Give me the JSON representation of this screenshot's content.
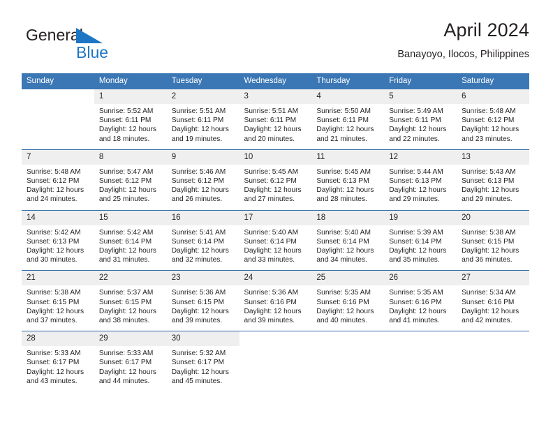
{
  "brand": {
    "name_top": "General",
    "name_bottom": "Blue",
    "logo_icon": "triangle-flag-icon",
    "color_top": "#231f20",
    "color_bottom": "#1d76c4"
  },
  "header": {
    "title": "April 2024",
    "subtitle": "Banayoyo, Ilocos, Philippines"
  },
  "theme": {
    "header_bg": "#3b77b5",
    "header_text": "#ffffff",
    "daynum_bg": "#efefef",
    "divider": "#2e6da4",
    "text": "#231f20"
  },
  "weekday_headers": [
    "Sunday",
    "Monday",
    "Tuesday",
    "Wednesday",
    "Thursday",
    "Friday",
    "Saturday"
  ],
  "weeks": [
    [
      {
        "day": "",
        "sunrise": "",
        "sunset": "",
        "daylight_1": "",
        "daylight_2": ""
      },
      {
        "day": "1",
        "sunrise": "Sunrise: 5:52 AM",
        "sunset": "Sunset: 6:11 PM",
        "daylight_1": "Daylight: 12 hours",
        "daylight_2": "and 18 minutes."
      },
      {
        "day": "2",
        "sunrise": "Sunrise: 5:51 AM",
        "sunset": "Sunset: 6:11 PM",
        "daylight_1": "Daylight: 12 hours",
        "daylight_2": "and 19 minutes."
      },
      {
        "day": "3",
        "sunrise": "Sunrise: 5:51 AM",
        "sunset": "Sunset: 6:11 PM",
        "daylight_1": "Daylight: 12 hours",
        "daylight_2": "and 20 minutes."
      },
      {
        "day": "4",
        "sunrise": "Sunrise: 5:50 AM",
        "sunset": "Sunset: 6:11 PM",
        "daylight_1": "Daylight: 12 hours",
        "daylight_2": "and 21 minutes."
      },
      {
        "day": "5",
        "sunrise": "Sunrise: 5:49 AM",
        "sunset": "Sunset: 6:11 PM",
        "daylight_1": "Daylight: 12 hours",
        "daylight_2": "and 22 minutes."
      },
      {
        "day": "6",
        "sunrise": "Sunrise: 5:48 AM",
        "sunset": "Sunset: 6:12 PM",
        "daylight_1": "Daylight: 12 hours",
        "daylight_2": "and 23 minutes."
      }
    ],
    [
      {
        "day": "7",
        "sunrise": "Sunrise: 5:48 AM",
        "sunset": "Sunset: 6:12 PM",
        "daylight_1": "Daylight: 12 hours",
        "daylight_2": "and 24 minutes."
      },
      {
        "day": "8",
        "sunrise": "Sunrise: 5:47 AM",
        "sunset": "Sunset: 6:12 PM",
        "daylight_1": "Daylight: 12 hours",
        "daylight_2": "and 25 minutes."
      },
      {
        "day": "9",
        "sunrise": "Sunrise: 5:46 AM",
        "sunset": "Sunset: 6:12 PM",
        "daylight_1": "Daylight: 12 hours",
        "daylight_2": "and 26 minutes."
      },
      {
        "day": "10",
        "sunrise": "Sunrise: 5:45 AM",
        "sunset": "Sunset: 6:12 PM",
        "daylight_1": "Daylight: 12 hours",
        "daylight_2": "and 27 minutes."
      },
      {
        "day": "11",
        "sunrise": "Sunrise: 5:45 AM",
        "sunset": "Sunset: 6:13 PM",
        "daylight_1": "Daylight: 12 hours",
        "daylight_2": "and 28 minutes."
      },
      {
        "day": "12",
        "sunrise": "Sunrise: 5:44 AM",
        "sunset": "Sunset: 6:13 PM",
        "daylight_1": "Daylight: 12 hours",
        "daylight_2": "and 29 minutes."
      },
      {
        "day": "13",
        "sunrise": "Sunrise: 5:43 AM",
        "sunset": "Sunset: 6:13 PM",
        "daylight_1": "Daylight: 12 hours",
        "daylight_2": "and 29 minutes."
      }
    ],
    [
      {
        "day": "14",
        "sunrise": "Sunrise: 5:42 AM",
        "sunset": "Sunset: 6:13 PM",
        "daylight_1": "Daylight: 12 hours",
        "daylight_2": "and 30 minutes."
      },
      {
        "day": "15",
        "sunrise": "Sunrise: 5:42 AM",
        "sunset": "Sunset: 6:14 PM",
        "daylight_1": "Daylight: 12 hours",
        "daylight_2": "and 31 minutes."
      },
      {
        "day": "16",
        "sunrise": "Sunrise: 5:41 AM",
        "sunset": "Sunset: 6:14 PM",
        "daylight_1": "Daylight: 12 hours",
        "daylight_2": "and 32 minutes."
      },
      {
        "day": "17",
        "sunrise": "Sunrise: 5:40 AM",
        "sunset": "Sunset: 6:14 PM",
        "daylight_1": "Daylight: 12 hours",
        "daylight_2": "and 33 minutes."
      },
      {
        "day": "18",
        "sunrise": "Sunrise: 5:40 AM",
        "sunset": "Sunset: 6:14 PM",
        "daylight_1": "Daylight: 12 hours",
        "daylight_2": "and 34 minutes."
      },
      {
        "day": "19",
        "sunrise": "Sunrise: 5:39 AM",
        "sunset": "Sunset: 6:14 PM",
        "daylight_1": "Daylight: 12 hours",
        "daylight_2": "and 35 minutes."
      },
      {
        "day": "20",
        "sunrise": "Sunrise: 5:38 AM",
        "sunset": "Sunset: 6:15 PM",
        "daylight_1": "Daylight: 12 hours",
        "daylight_2": "and 36 minutes."
      }
    ],
    [
      {
        "day": "21",
        "sunrise": "Sunrise: 5:38 AM",
        "sunset": "Sunset: 6:15 PM",
        "daylight_1": "Daylight: 12 hours",
        "daylight_2": "and 37 minutes."
      },
      {
        "day": "22",
        "sunrise": "Sunrise: 5:37 AM",
        "sunset": "Sunset: 6:15 PM",
        "daylight_1": "Daylight: 12 hours",
        "daylight_2": "and 38 minutes."
      },
      {
        "day": "23",
        "sunrise": "Sunrise: 5:36 AM",
        "sunset": "Sunset: 6:15 PM",
        "daylight_1": "Daylight: 12 hours",
        "daylight_2": "and 39 minutes."
      },
      {
        "day": "24",
        "sunrise": "Sunrise: 5:36 AM",
        "sunset": "Sunset: 6:16 PM",
        "daylight_1": "Daylight: 12 hours",
        "daylight_2": "and 39 minutes."
      },
      {
        "day": "25",
        "sunrise": "Sunrise: 5:35 AM",
        "sunset": "Sunset: 6:16 PM",
        "daylight_1": "Daylight: 12 hours",
        "daylight_2": "and 40 minutes."
      },
      {
        "day": "26",
        "sunrise": "Sunrise: 5:35 AM",
        "sunset": "Sunset: 6:16 PM",
        "daylight_1": "Daylight: 12 hours",
        "daylight_2": "and 41 minutes."
      },
      {
        "day": "27",
        "sunrise": "Sunrise: 5:34 AM",
        "sunset": "Sunset: 6:16 PM",
        "daylight_1": "Daylight: 12 hours",
        "daylight_2": "and 42 minutes."
      }
    ],
    [
      {
        "day": "28",
        "sunrise": "Sunrise: 5:33 AM",
        "sunset": "Sunset: 6:17 PM",
        "daylight_1": "Daylight: 12 hours",
        "daylight_2": "and 43 minutes."
      },
      {
        "day": "29",
        "sunrise": "Sunrise: 5:33 AM",
        "sunset": "Sunset: 6:17 PM",
        "daylight_1": "Daylight: 12 hours",
        "daylight_2": "and 44 minutes."
      },
      {
        "day": "30",
        "sunrise": "Sunrise: 5:32 AM",
        "sunset": "Sunset: 6:17 PM",
        "daylight_1": "Daylight: 12 hours",
        "daylight_2": "and 45 minutes."
      },
      {
        "day": "",
        "sunrise": "",
        "sunset": "",
        "daylight_1": "",
        "daylight_2": ""
      },
      {
        "day": "",
        "sunrise": "",
        "sunset": "",
        "daylight_1": "",
        "daylight_2": ""
      },
      {
        "day": "",
        "sunrise": "",
        "sunset": "",
        "daylight_1": "",
        "daylight_2": ""
      },
      {
        "day": "",
        "sunrise": "",
        "sunset": "",
        "daylight_1": "",
        "daylight_2": ""
      }
    ]
  ]
}
